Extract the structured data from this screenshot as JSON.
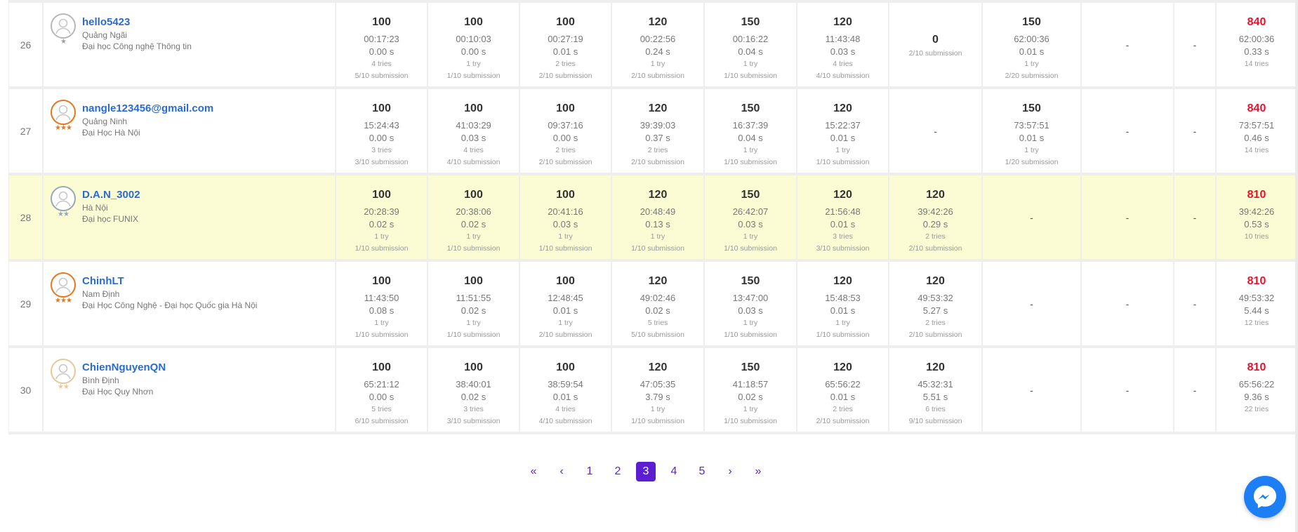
{
  "rows": [
    {
      "rank": "26",
      "name": "hello5423",
      "location": "Quảng Ngãi",
      "org": "Đại học Công nghệ Thông tin",
      "stars": "★",
      "star_color": "#9e9e9e",
      "ring_color": "#b7b7b7",
      "highlight": false,
      "problems": [
        {
          "score": "100",
          "time": "00:17:23",
          "runtime": "0.00 s",
          "tries": "4 tries",
          "submissions": "5/10 submission"
        },
        {
          "score": "100",
          "time": "00:10:03",
          "runtime": "0.00 s",
          "tries": "1 try",
          "submissions": "1/10 submission"
        },
        {
          "score": "100",
          "time": "00:27:19",
          "runtime": "0.01 s",
          "tries": "2 tries",
          "submissions": "2/10 submission"
        },
        {
          "score": "120",
          "time": "00:22:56",
          "runtime": "0.24 s",
          "tries": "1 try",
          "submissions": "2/10 submission"
        },
        {
          "score": "150",
          "time": "00:16:22",
          "runtime": "0.04 s",
          "tries": "1 try",
          "submissions": "1/10 submission"
        },
        {
          "score": "120",
          "time": "11:43:48",
          "runtime": "0.03 s",
          "tries": "4 tries",
          "submissions": "4/10 submission"
        },
        {
          "score": "0",
          "submissions": "2/10 submission",
          "zero": true
        },
        {
          "score": "150",
          "time": "62:00:36",
          "runtime": "0.01 s",
          "tries": "1 try",
          "submissions": "2/20 submission"
        },
        {
          "dash": "-"
        },
        {
          "dash": "-"
        }
      ],
      "total": {
        "score": "840",
        "time": "62:00:36",
        "runtime": "0.33 s",
        "tries": "14 tries"
      }
    },
    {
      "rank": "27",
      "name": "nangle123456@gmail.com",
      "location": "Quảng Ninh",
      "org": "Đại Học Hà Nội",
      "stars": "★★★",
      "star_color": "#e5761c",
      "ring_color": "#e5761c",
      "highlight": false,
      "problems": [
        {
          "score": "100",
          "time": "15:24:43",
          "runtime": "0.00 s",
          "tries": "3 tries",
          "submissions": "3/10 submission"
        },
        {
          "score": "100",
          "time": "41:03:29",
          "runtime": "0.03 s",
          "tries": "4 tries",
          "submissions": "4/10 submission"
        },
        {
          "score": "100",
          "time": "09:37:16",
          "runtime": "0.00 s",
          "tries": "2 tries",
          "submissions": "2/10 submission"
        },
        {
          "score": "120",
          "time": "39:39:03",
          "runtime": "0.37 s",
          "tries": "2 tries",
          "submissions": "2/10 submission"
        },
        {
          "score": "150",
          "time": "16:37:39",
          "runtime": "0.04 s",
          "tries": "1 try",
          "submissions": "1/10 submission"
        },
        {
          "score": "120",
          "time": "15:22:37",
          "runtime": "0.01 s",
          "tries": "1 try",
          "submissions": "1/10 submission"
        },
        {
          "dash": "-"
        },
        {
          "score": "150",
          "time": "73:57:51",
          "runtime": "0.01 s",
          "tries": "1 try",
          "submissions": "1/20 submission"
        },
        {
          "dash": "-"
        },
        {
          "dash": "-"
        }
      ],
      "total": {
        "score": "840",
        "time": "73:57:51",
        "runtime": "0.46 s",
        "tries": "14 tries"
      }
    },
    {
      "rank": "28",
      "name": "D.A.N_3002",
      "location": "Hà Nội",
      "org": "Đại học FUNIX",
      "stars": "★★",
      "star_color": "#9aa7b5",
      "ring_color": "#9aa7b5",
      "highlight": true,
      "problems": [
        {
          "score": "100",
          "time": "20:28:39",
          "runtime": "0.02 s",
          "tries": "1 try",
          "submissions": "1/10 submission"
        },
        {
          "score": "100",
          "time": "20:38:06",
          "runtime": "0.02 s",
          "tries": "1 try",
          "submissions": "1/10 submission"
        },
        {
          "score": "100",
          "time": "20:41:16",
          "runtime": "0.03 s",
          "tries": "1 try",
          "submissions": "1/10 submission"
        },
        {
          "score": "120",
          "time": "20:48:49",
          "runtime": "0.13 s",
          "tries": "1 try",
          "submissions": "1/10 submission"
        },
        {
          "score": "150",
          "time": "26:42:07",
          "runtime": "0.03 s",
          "tries": "1 try",
          "submissions": "1/10 submission"
        },
        {
          "score": "120",
          "time": "21:56:48",
          "runtime": "0.01 s",
          "tries": "3 tries",
          "submissions": "3/10 submission"
        },
        {
          "score": "120",
          "time": "39:42:26",
          "runtime": "0.29 s",
          "tries": "2 tries",
          "submissions": "2/10 submission"
        },
        {
          "dash": "-"
        },
        {
          "dash": "-"
        },
        {
          "dash": "-"
        }
      ],
      "total": {
        "score": "810",
        "time": "39:42:26",
        "runtime": "0.53 s",
        "tries": "10 tries"
      }
    },
    {
      "rank": "29",
      "name": "ChinhLT",
      "location": "Nam Định",
      "org": "Đại Học Công Nghệ - Đại học Quốc gia Hà Nội",
      "stars": "★★★",
      "star_color": "#e5761c",
      "ring_color": "#e5761c",
      "highlight": false,
      "problems": [
        {
          "score": "100",
          "time": "11:43:50",
          "runtime": "0.08 s",
          "tries": "1 try",
          "submissions": "1/10 submission"
        },
        {
          "score": "100",
          "time": "11:51:55",
          "runtime": "0.02 s",
          "tries": "1 try",
          "submissions": "1/10 submission"
        },
        {
          "score": "100",
          "time": "12:48:45",
          "runtime": "0.01 s",
          "tries": "1 try",
          "submissions": "2/10 submission"
        },
        {
          "score": "120",
          "time": "49:02:46",
          "runtime": "0.02 s",
          "tries": "5 tries",
          "submissions": "5/10 submission"
        },
        {
          "score": "150",
          "time": "13:47:00",
          "runtime": "0.03 s",
          "tries": "1 try",
          "submissions": "1/10 submission"
        },
        {
          "score": "120",
          "time": "15:48:53",
          "runtime": "0.01 s",
          "tries": "1 try",
          "submissions": "1/10 submission"
        },
        {
          "score": "120",
          "time": "49:53:32",
          "runtime": "5.27 s",
          "tries": "2 tries",
          "submissions": "2/10 submission"
        },
        {
          "dash": "-"
        },
        {
          "dash": "-"
        },
        {
          "dash": "-"
        }
      ],
      "total": {
        "score": "810",
        "time": "49:53:32",
        "runtime": "5.44 s",
        "tries": "12 tries"
      }
    },
    {
      "rank": "30",
      "name": "ChienNguyenQN",
      "location": "Bình Định",
      "org": "Đại Học Quy Nhơn",
      "stars": "★★",
      "star_color": "#e8c79a",
      "ring_color": "#e8c79a",
      "highlight": false,
      "problems": [
        {
          "score": "100",
          "time": "65:21:12",
          "runtime": "0.00 s",
          "tries": "5 tries",
          "submissions": "6/10 submission"
        },
        {
          "score": "100",
          "time": "38:40:01",
          "runtime": "0.02 s",
          "tries": "3 tries",
          "submissions": "3/10 submission"
        },
        {
          "score": "100",
          "time": "38:59:54",
          "runtime": "0.01 s",
          "tries": "4 tries",
          "submissions": "4/10 submission"
        },
        {
          "score": "120",
          "time": "47:05:35",
          "runtime": "3.79 s",
          "tries": "1 try",
          "submissions": "1/10 submission"
        },
        {
          "score": "150",
          "time": "41:18:57",
          "runtime": "0.02 s",
          "tries": "1 try",
          "submissions": "1/10 submission"
        },
        {
          "score": "120",
          "time": "65:56:22",
          "runtime": "0.01 s",
          "tries": "2 tries",
          "submissions": "2/10 submission"
        },
        {
          "score": "120",
          "time": "45:32:31",
          "runtime": "5.51 s",
          "tries": "6 tries",
          "submissions": "9/10 submission"
        },
        {
          "dash": "-"
        },
        {
          "dash": "-"
        },
        {
          "dash": "-"
        }
      ],
      "total": {
        "score": "810",
        "time": "65:56:22",
        "runtime": "9.36 s",
        "tries": "22 tries"
      }
    }
  ],
  "pagination": {
    "first": "«",
    "prev": "‹",
    "pages": [
      "1",
      "2",
      "3",
      "4",
      "5"
    ],
    "current": "3",
    "next": "›",
    "last": "»"
  },
  "colors": {
    "accent": "#5b1fd1",
    "link": "#2a6bd2",
    "total_score": "#e8112d",
    "highlight_row": "#fbfcd3",
    "messenger": "#1d7ff5"
  },
  "icons": {
    "avatar_default": "user-avatar-icon",
    "messenger": "messenger-icon"
  }
}
